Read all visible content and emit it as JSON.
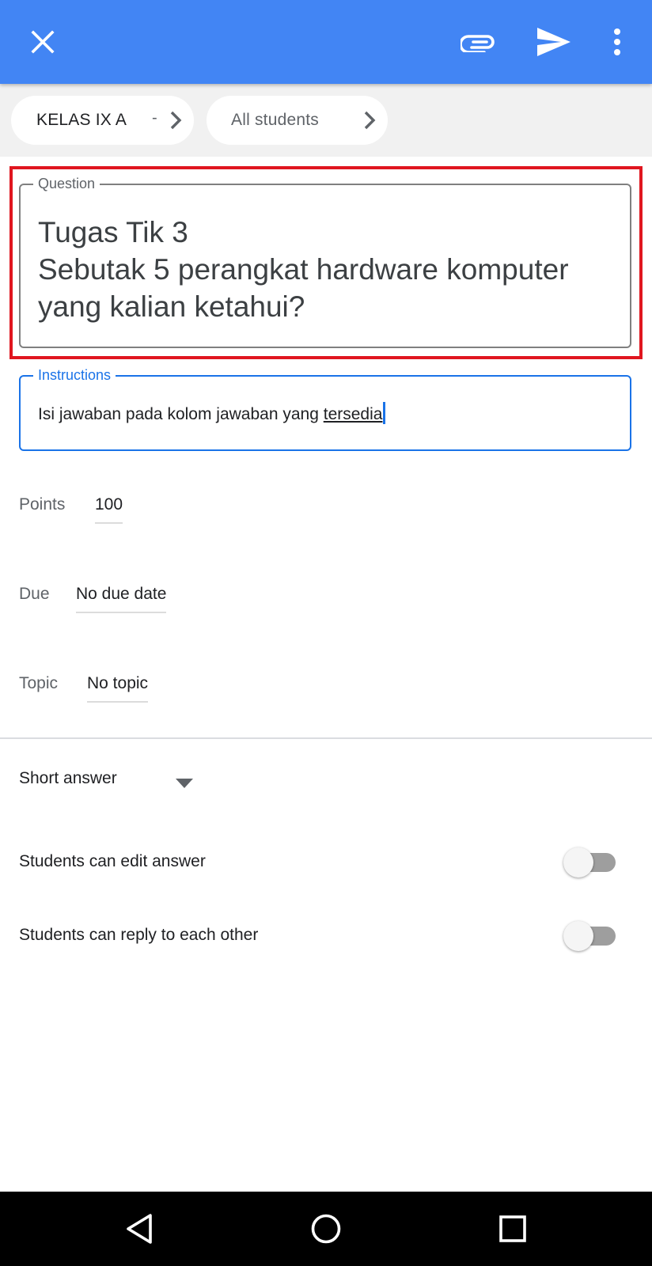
{
  "app_bar": {
    "background": "#4285f4",
    "icons": [
      "close-icon",
      "attach-icon",
      "send-icon",
      "more-vert-icon"
    ]
  },
  "chips": {
    "class_label": "KELAS IX A",
    "class_separator": "-",
    "students_label": "All students"
  },
  "question": {
    "label": "Question",
    "text": "Tugas Tik 3\nSebutak 5 perangkat hardware komputer yang kalian ketahui?"
  },
  "instructions": {
    "label": "Instructions",
    "text_before": "Isi jawaban pada kolom jawaban yang ",
    "text_underlined": "tersedia"
  },
  "points": {
    "label": "Points",
    "value": "100"
  },
  "due": {
    "label": "Due",
    "value": "No due date"
  },
  "topic": {
    "label": "Topic",
    "value": "No topic"
  },
  "answer_type": {
    "selected": "Short answer"
  },
  "options": {
    "edit_answer": {
      "label": "Students can edit answer",
      "on": false
    },
    "reply_each_other": {
      "label": "Students can reply to each other",
      "on": false
    }
  },
  "colors": {
    "accent": "#1a73e8",
    "highlight": "#e0161f"
  },
  "nav_bar": {
    "icons": [
      "back-icon",
      "home-icon",
      "recents-icon"
    ]
  }
}
